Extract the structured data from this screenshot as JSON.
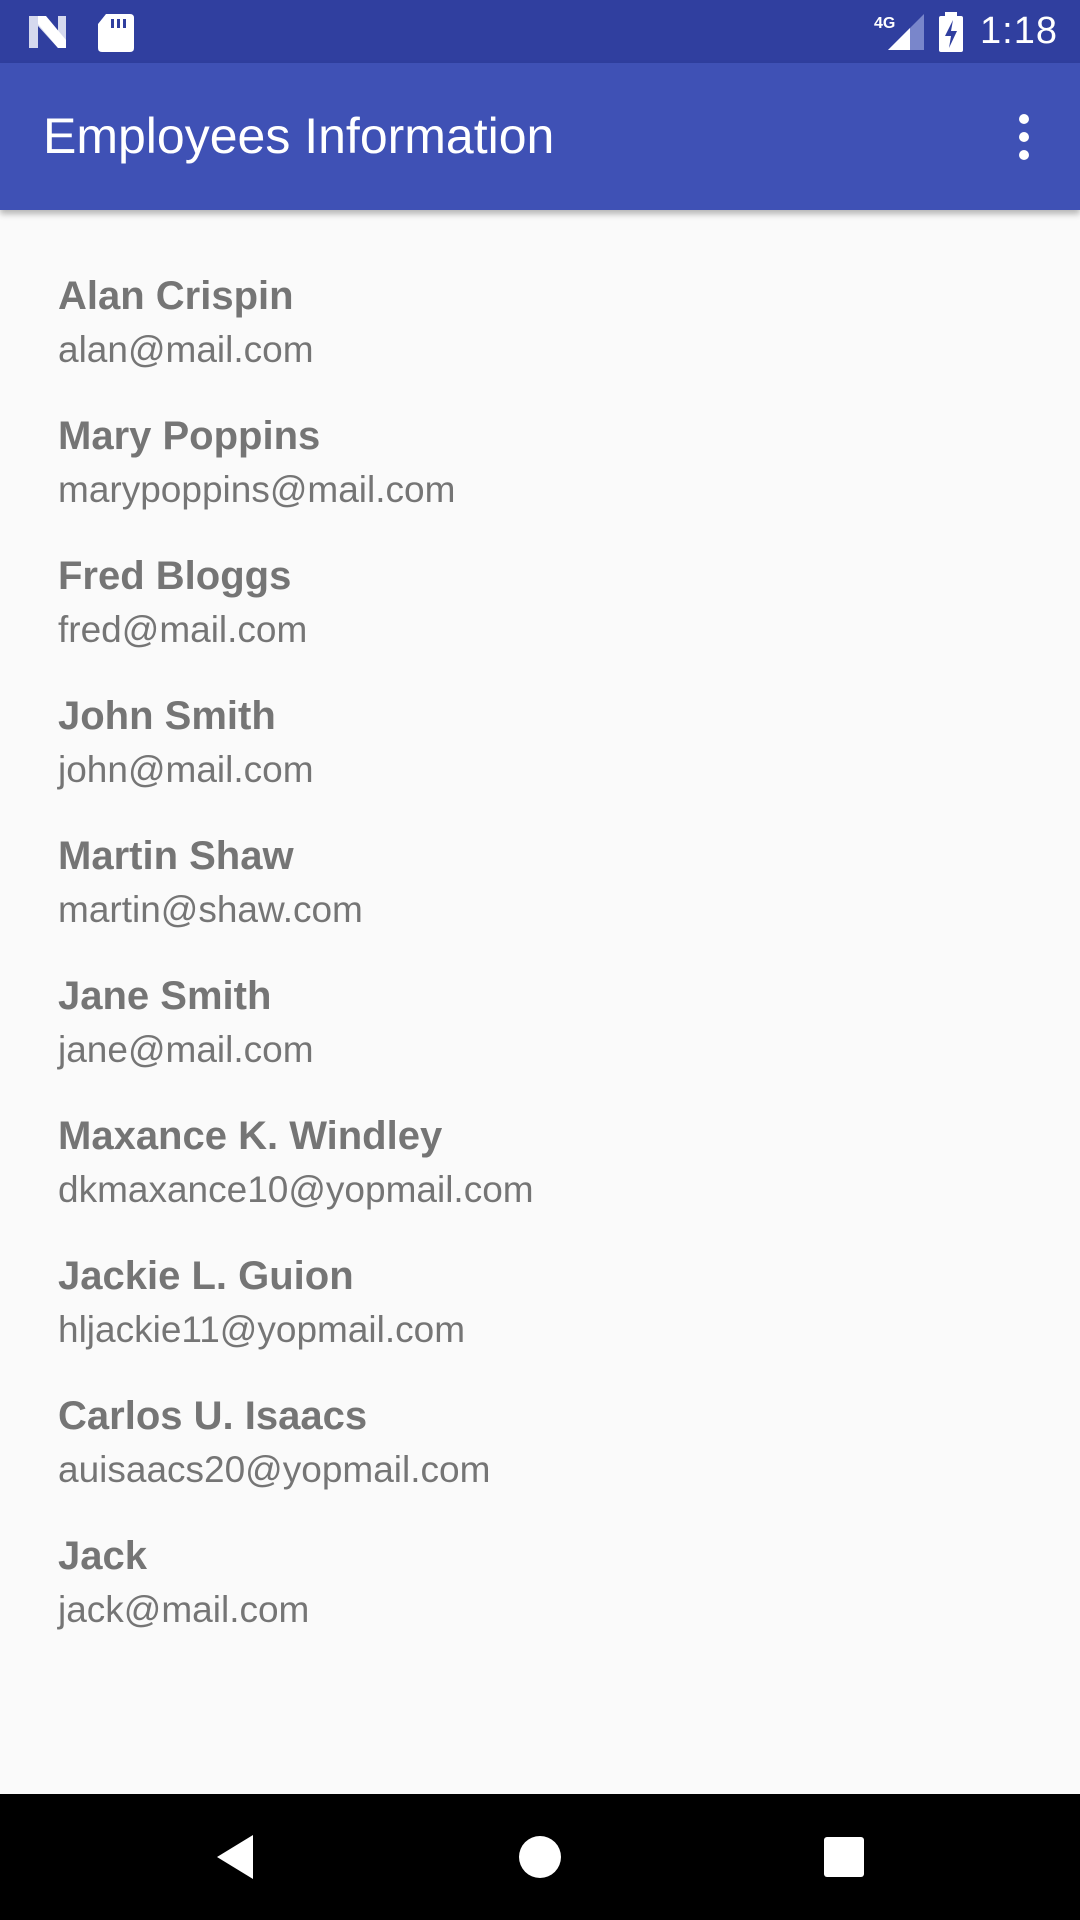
{
  "status_bar": {
    "time": "1:18",
    "network_label": "4G",
    "icons": [
      "n-logo-icon",
      "sd-card-icon",
      "signal-4g-icon",
      "battery-charging-icon"
    ]
  },
  "app_bar": {
    "title": "Employees Information",
    "overflow_icon": "more-vert-icon"
  },
  "employees": [
    {
      "name": "Alan Crispin",
      "email": "alan@mail.com"
    },
    {
      "name": "Mary Poppins",
      "email": "marypoppins@mail.com"
    },
    {
      "name": "Fred Bloggs",
      "email": "fred@mail.com"
    },
    {
      "name": "John Smith",
      "email": "john@mail.com"
    },
    {
      "name": "Martin Shaw",
      "email": "martin@shaw.com"
    },
    {
      "name": "Jane Smith",
      "email": "jane@mail.com"
    },
    {
      "name": "Maxance K. Windley",
      "email": "dkmaxance10@yopmail.com"
    },
    {
      "name": "Jackie L. Guion",
      "email": "hljackie11@yopmail.com"
    },
    {
      "name": "Carlos U. Isaacs",
      "email": "auisaacs20@yopmail.com"
    },
    {
      "name": "Jack",
      "email": "jack@mail.com"
    }
  ],
  "nav_bar": {
    "icons": [
      "back-icon",
      "home-icon",
      "recents-icon"
    ]
  },
  "colors": {
    "status_bar": "#303f9f",
    "app_bar": "#3f51b5",
    "background": "#fafafa",
    "list_text": "#757575",
    "nav_bar": "#000000"
  }
}
